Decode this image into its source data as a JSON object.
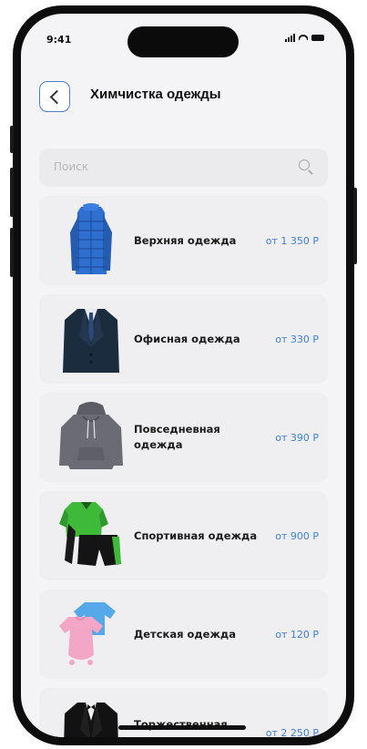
{
  "status": {
    "time": "9:41"
  },
  "header": {
    "title": "Химчистка одежды"
  },
  "search": {
    "placeholder": "Поиск"
  },
  "items": [
    {
      "name": "Верхняя одежда",
      "price": "от 1 350 Р",
      "icon": "jacket-icon"
    },
    {
      "name": "Офисная одежда",
      "price": "от 330 Р",
      "icon": "suit-icon"
    },
    {
      "name": "Повседневная одежда",
      "price": "от 390 Р",
      "icon": "hoodie-icon"
    },
    {
      "name": "Спортивная одежда",
      "price": "от 900 Р",
      "icon": "sportswear-icon"
    },
    {
      "name": "Детская одежда",
      "price": "от 120 Р",
      "icon": "kids-clothes-icon"
    },
    {
      "name": "Торжественная одежда",
      "price": "от 2 250 Р",
      "icon": "tuxedo-icon"
    }
  ],
  "colors": {
    "accent": "#3f7fd6",
    "background": "#f4f4f6",
    "card": "#efeff1"
  }
}
